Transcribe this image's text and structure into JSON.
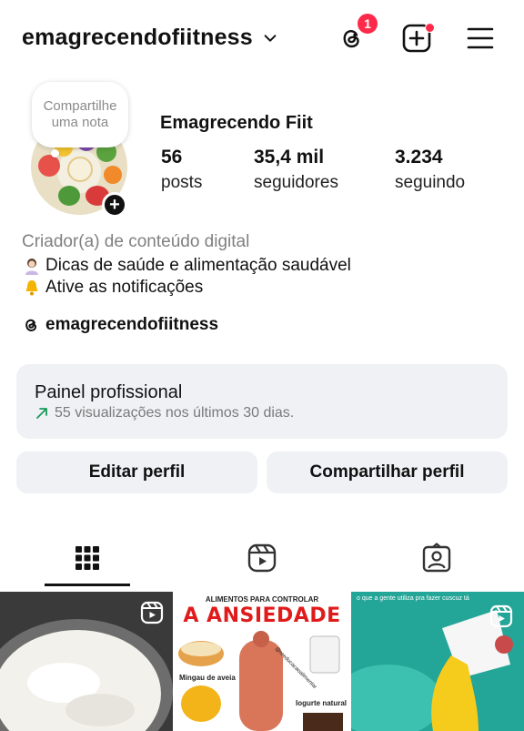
{
  "header": {
    "username": "emagrecendofiitness",
    "notification_count": "1"
  },
  "profile": {
    "note": "Compartilhe uma nota",
    "display_name": "Emagrecendo Fiit",
    "stats": [
      {
        "value": "56",
        "label": "posts"
      },
      {
        "value": "35,4 mil",
        "label": "seguidores"
      },
      {
        "value": "3.234",
        "label": "seguindo"
      }
    ],
    "category": "Criador(a) de conteúdo digital",
    "bio": [
      "Dicas de saúde e alimentação saudável",
      "Ative as notificações"
    ],
    "threads_handle": "emagrecendofiitness"
  },
  "pro_panel": {
    "title": "Painel profissional",
    "subtitle": "55 visualizações nos últimos 30 dias."
  },
  "buttons": {
    "edit": "Editar perfil",
    "share": "Compartilhar perfil"
  },
  "tabs": [
    "grid-icon",
    "reels-icon",
    "tagged-icon"
  ],
  "thumbnails": [
    {
      "kind": "reel"
    },
    {
      "kind": "reel",
      "top_text": "ALIMENTOS PARA CONTROLAR",
      "headline": "A ANSIEDADE",
      "captions": [
        "Mingau de aveia",
        "Iogurte natural",
        "@reeducacaoalimentar"
      ]
    },
    {
      "kind": "reel",
      "caption": "o que a gente utiliza pra fazer cuscuz tá"
    }
  ],
  "colors": {
    "badge": "#ff2a4a",
    "panel_bg": "#eff1f4",
    "headline_red": "#e01b1b"
  }
}
